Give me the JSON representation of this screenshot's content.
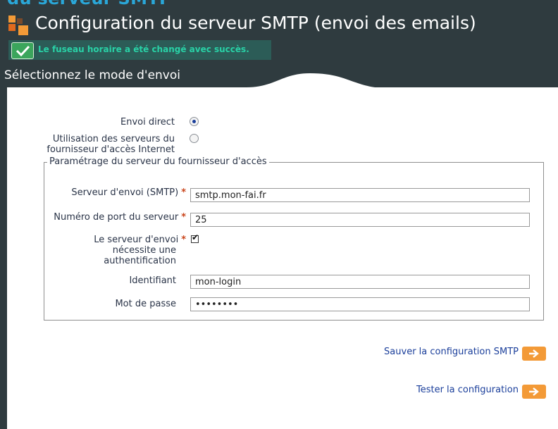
{
  "header": {
    "cut_title": "du serveur SMTP",
    "title": "Configuration du serveur SMTP (envoi des emails)"
  },
  "notification": {
    "message": "Le fuseau horaire a été changé avec succès."
  },
  "section": {
    "title": "Sélectionnez le mode d'envoi"
  },
  "send_mode": {
    "direct_label": "Envoi direct",
    "isp_label_line1": "Utilisation des serveurs du",
    "isp_label_line2": "fournisseur d'accès Internet",
    "selected": "direct"
  },
  "isp_settings": {
    "legend": "Paramétrage du serveur du fournisseur d'accès",
    "smtp_server_label": "Serveur d'envoi (SMTP)",
    "smtp_server_value": "smtp.mon-fai.fr",
    "port_label": "Numéro de port du serveur",
    "port_value": "25",
    "auth_label_line1": "Le serveur d'envoi",
    "auth_label_line2": "nécessite une",
    "auth_label_line3": "authentification",
    "auth_checked": true,
    "login_label": "Identifiant",
    "login_value": "mon-login",
    "password_label": "Mot de passe",
    "password_value": "••••••••",
    "required_mark": "*"
  },
  "actions": {
    "save_label": "Sauver la configuration SMTP",
    "test_label": "Tester la configuration"
  },
  "colors": {
    "header_bg": "#2f3b3f",
    "accent_orange": "#f39a37",
    "success_text": "#29d1a6",
    "link_blue": "#1b3f9b"
  },
  "icons": [
    "logo-squares-icon",
    "check-icon",
    "radio-icon",
    "checkbox-icon",
    "arrow-right-icon"
  ]
}
